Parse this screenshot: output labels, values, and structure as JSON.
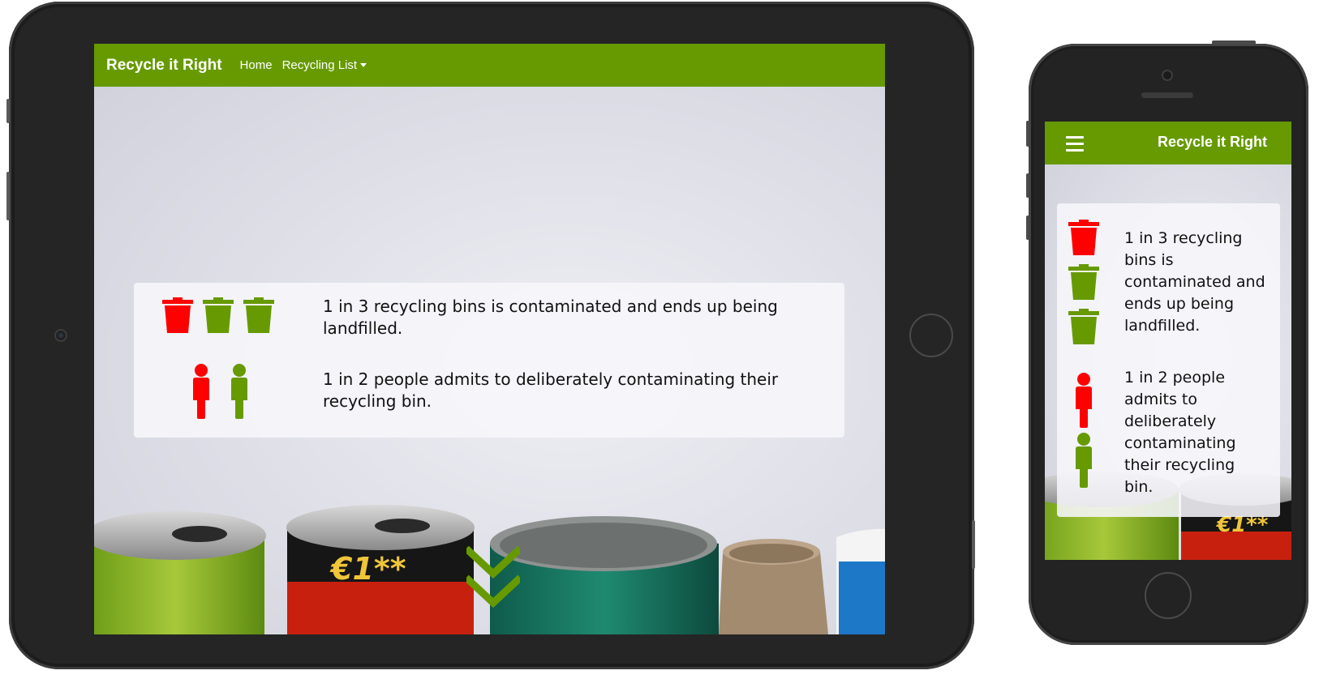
{
  "brand": "Recycle it Right",
  "nav": {
    "home_label": "Home",
    "recycling_list_label": "Recycling List"
  },
  "facts": [
    {
      "text": "1 in 3 recycling bins is contaminated and ends up being landfilled.",
      "icon": "trash-bin-icon",
      "highlighted": 1,
      "total": 3
    },
    {
      "text": "1 in 2 people admits to deliberately contaminating their recycling bin.",
      "icon": "person-icon",
      "highlighted": 1,
      "total": 2
    }
  ],
  "can_label": "€1**",
  "colors": {
    "brand_green": "#669a00",
    "alert_red": "#ff0000",
    "icon_green": "#669a00"
  },
  "icons": {
    "menu": "hamburger-menu-icon",
    "scroll_down": "double-chevron-down-icon"
  }
}
